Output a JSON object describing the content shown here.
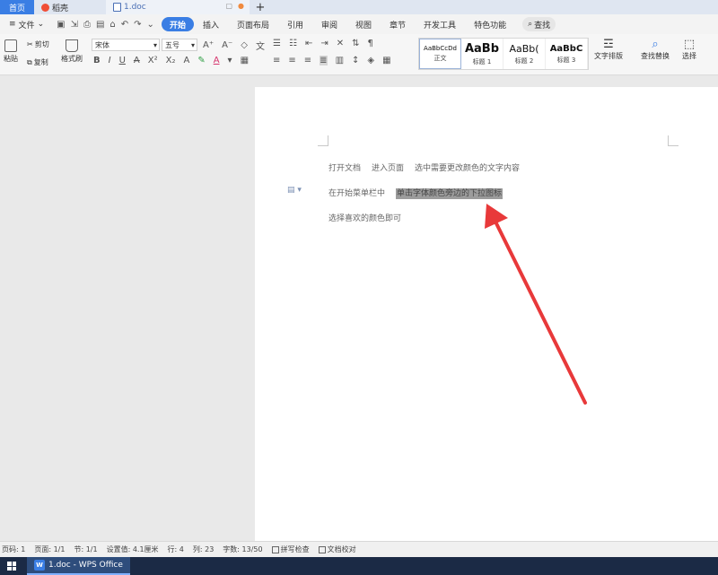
{
  "tabs": {
    "home": "首页",
    "docer": "稻壳",
    "doc": "1.doc"
  },
  "menu": {
    "file": "文件",
    "items": [
      "开始",
      "插入",
      "页面布局",
      "引用",
      "审阅",
      "视图",
      "章节",
      "开发工具",
      "特色功能"
    ],
    "search": "查找"
  },
  "ribbon": {
    "paste": "粘贴",
    "cut": "剪切",
    "copy": "复制",
    "format_painter": "格式刷",
    "font": "宋体",
    "font_size": "五号",
    "styles": [
      {
        "sample": "AaBbCcDd",
        "name": "正文"
      },
      {
        "sample": "AaBb",
        "name": "标题 1"
      },
      {
        "sample": "AaBb(",
        "name": "标题 2"
      },
      {
        "sample": "AaBbC",
        "name": "标题 3"
      }
    ],
    "text_layout": "文字排版",
    "find_replace": "查找替换",
    "select": "选择"
  },
  "document": {
    "line1": [
      "打开文档",
      "进入页面",
      "选中需要更改颜色的文字内容"
    ],
    "line2_prefix": "在开始菜单栏中",
    "line2_highlight": "单击字体颜色旁边的下拉图标",
    "line3": "选择喜欢的颜色即可"
  },
  "status": {
    "page_num": "页码: 1",
    "pages": "页面: 1/1",
    "section": "节: 1/1",
    "setting": "设置值: 4.1厘米",
    "row": "行: 4",
    "col": "列: 23",
    "words": "字数: 13/50",
    "spell": "拼写检查",
    "proof": "文档校对"
  },
  "taskbar": {
    "app": "1.doc - WPS Office"
  },
  "colors": {
    "accent": "#3a7ee4",
    "arrow": "#e8393a",
    "highlight": "#9c9c9c"
  }
}
